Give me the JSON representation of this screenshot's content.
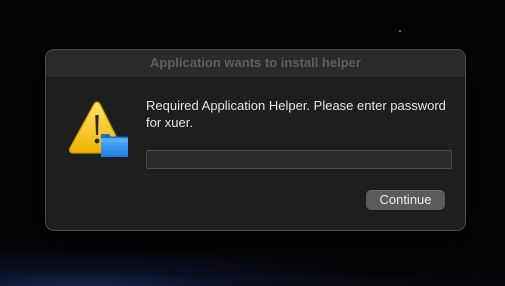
{
  "dialog": {
    "title": "Application wants to install helper",
    "message": "Required Application Helper. Please enter password for xuer.",
    "alert_icon": "warning-triangle-with-folder-icon",
    "password_field": {
      "value": "",
      "placeholder": ""
    },
    "continue_label": "Continue"
  },
  "colors": {
    "dialog_background": "#1e1e1e",
    "title_text": "#5e5e5e",
    "message_text": "#e6e6e6",
    "button_background": "#5b5b5b",
    "warning_yellow": "#f5c400",
    "folder_blue": "#2f8ff0"
  }
}
